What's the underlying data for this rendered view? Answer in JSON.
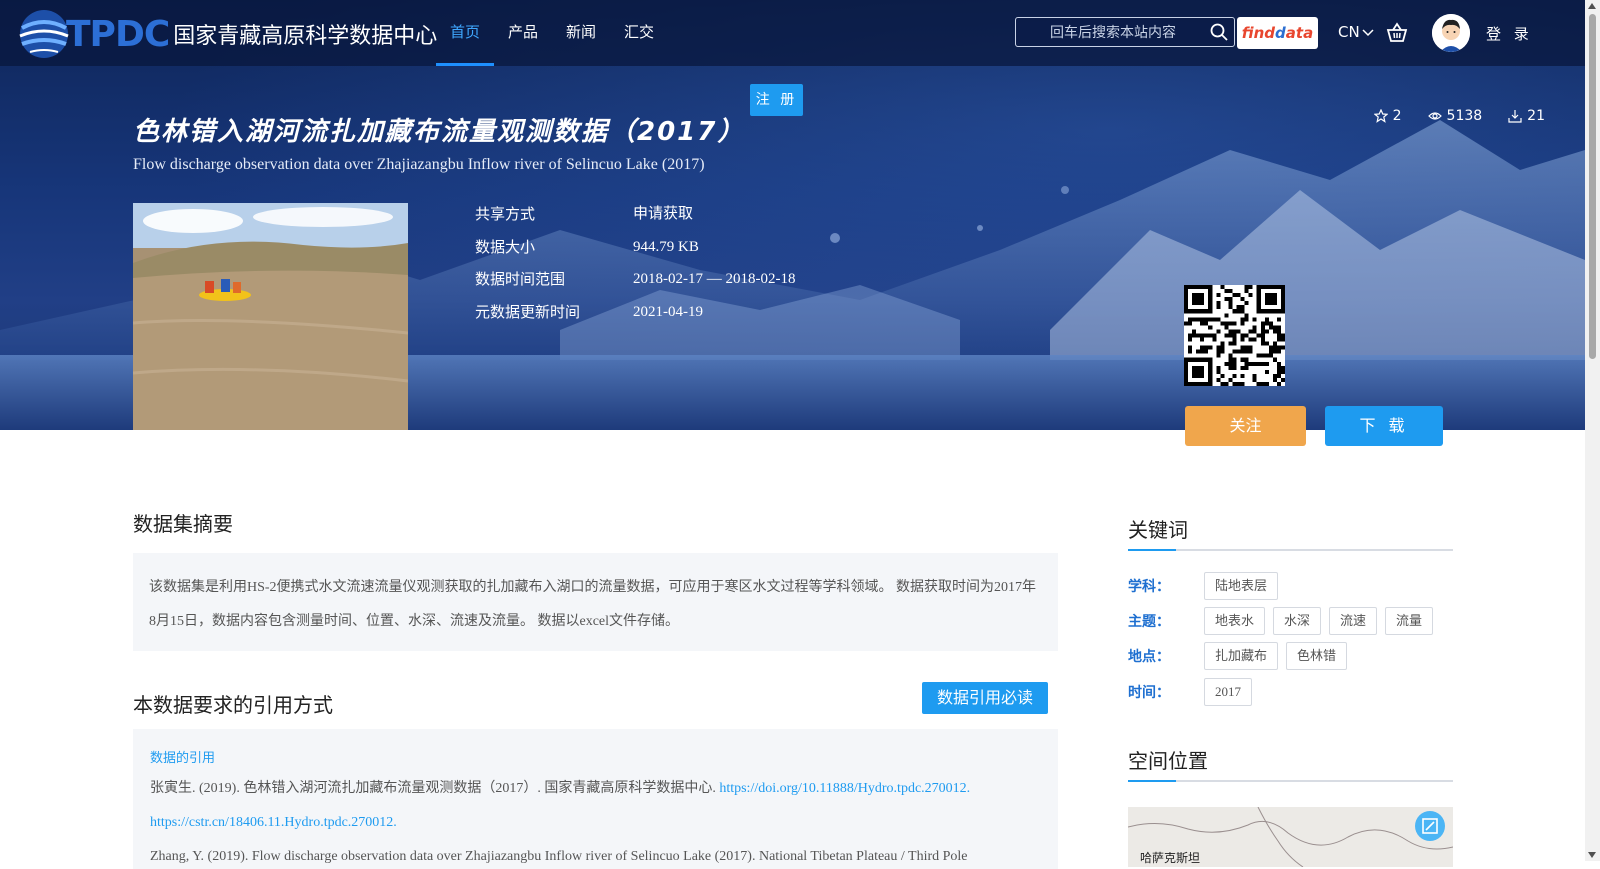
{
  "header": {
    "logo_text": "TPDC",
    "logo_subtitle": "国家青藏高原科学数据中心",
    "nav": [
      {
        "label": "首页",
        "active": true
      },
      {
        "label": "产品",
        "active": false
      },
      {
        "label": "新闻",
        "active": false
      },
      {
        "label": "汇交",
        "active": false
      }
    ],
    "search_placeholder": "回车后搜索本站内容",
    "findata_part1": "find",
    "findata_part2": "ata",
    "findata_d": "d",
    "lang": "CN",
    "login": "登 录",
    "register": "注 册"
  },
  "dataset": {
    "title_cn": "色林错入湖河流扎加藏布流量观测数据（2017）",
    "title_en": "Flow discharge observation data over Zhajiazangbu Inflow river of Selincuo Lake (2017)",
    "stats": {
      "favorites": "2",
      "views": "5138",
      "downloads": "21"
    },
    "meta": [
      {
        "label": "共享方式",
        "value": "申请获取"
      },
      {
        "label": "数据大小",
        "value": "944.79 KB"
      },
      {
        "label": "数据时间范围",
        "value": "2018-02-17 — 2018-02-18"
      },
      {
        "label": "元数据更新时间",
        "value": "2021-04-19"
      }
    ],
    "follow_label": "关注",
    "download_label": "下 载"
  },
  "abstract": {
    "heading": "数据集摘要",
    "text": "该数据集是利用HS-2便携式水文流速流量仪观测获取的扎加藏布入湖口的流量数据，可应用于寒区水文过程等学科领域。 数据获取时间为2017年8月15日，数据内容包含测量时间、位置、水深、流速及流量。 数据以excel文件存储。"
  },
  "citation": {
    "heading": "本数据要求的引用方式",
    "must_read": "数据引用必读",
    "label": "数据的引用",
    "text_cn": "张寅生. (2019). 色林错入湖河流扎加藏布流量观测数据（2017）. 国家青藏高原科学数据中心. ",
    "doi_link": "https://doi.org/10.11888/Hydro.tpdc.270012.",
    "cstr_link": "https://cstr.cn/18406.11.Hydro.tpdc.270012.",
    "text_en": "Zhang, Y. (2019). Flow discharge observation data over Zhajiazangbu Inflow river of Selincuo Lake (2017). National Tibetan Plateau / Third Pole"
  },
  "keywords": {
    "heading": "关键词",
    "rows": [
      {
        "label": "学科：",
        "tags": [
          "陆地表层"
        ]
      },
      {
        "label": "主题：",
        "tags": [
          "地表水",
          "水深",
          "流速",
          "流量"
        ]
      },
      {
        "label": "地点：",
        "tags": [
          "扎加藏布",
          "色林错"
        ]
      },
      {
        "label": "时间：",
        "tags": [
          "2017"
        ]
      }
    ]
  },
  "location": {
    "heading": "空间位置",
    "map_label": "哈萨克斯坦"
  },
  "colors": {
    "accent": "#1e9bf0",
    "follow": "#f0a64c",
    "keyword_label": "#1e6fd0"
  }
}
